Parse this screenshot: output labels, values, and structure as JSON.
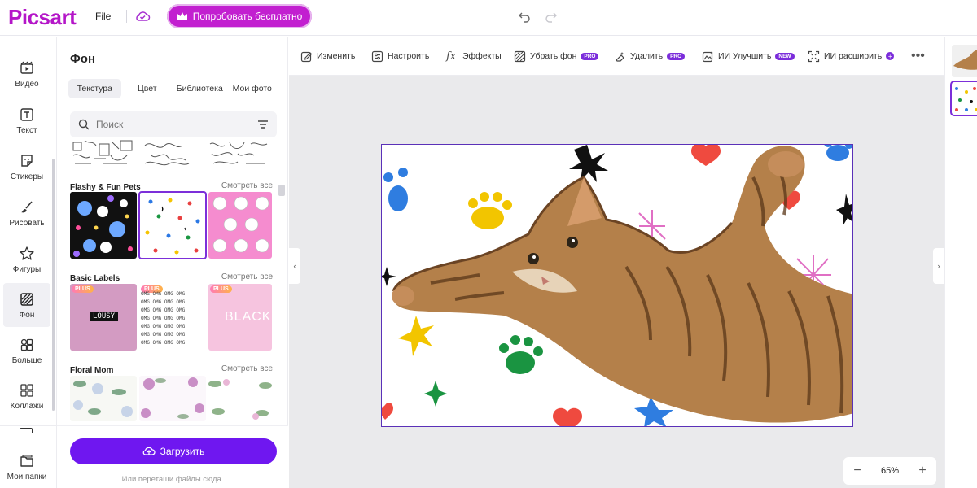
{
  "app": {
    "logo_text": "Picsart",
    "file_label": "File",
    "try_button_label": "Попробовать бесплатно"
  },
  "rail": {
    "items": [
      {
        "label": "Видео",
        "icon": "video-icon"
      },
      {
        "label": "Текст",
        "icon": "text-icon"
      },
      {
        "label": "Стикеры",
        "icon": "sticker-icon"
      },
      {
        "label": "Рисовать",
        "icon": "brush-icon"
      },
      {
        "label": "Фигуры",
        "icon": "star-icon"
      },
      {
        "label": "Фон",
        "icon": "background-icon",
        "active": true
      },
      {
        "label": "Больше",
        "icon": "grid-icon"
      },
      {
        "label": "Коллажи",
        "icon": "collage-icon"
      },
      {
        "label": "Мои папки",
        "icon": "folder-icon"
      }
    ]
  },
  "panel": {
    "title": "Фон",
    "tabs": [
      "Текстура",
      "Цвет",
      "Библиотека",
      "Мои фото"
    ],
    "active_tab": "Текстура",
    "search_placeholder": "Поиск",
    "sections": [
      {
        "title": "Flashy & Fun Pets",
        "see_all": "Смотреть все"
      },
      {
        "title": "Basic Labels",
        "see_all": "Смотреть все",
        "badges": [
          "PLUS",
          "PLUS",
          "PLUS"
        ],
        "thumb_texts": [
          "LOUSY",
          "OMG",
          "BLACK"
        ]
      },
      {
        "title": "Floral Mom",
        "see_all": "Смотреть все"
      }
    ],
    "upload_label": "Загрузить",
    "drop_hint": "Или перетащи файлы сюда."
  },
  "toolbar": {
    "tools": [
      {
        "label": "Изменить",
        "icon": "edit-icon"
      },
      {
        "label": "Настроить",
        "icon": "adjust-icon"
      },
      {
        "label": "Эффекты",
        "icon": "fx-icon"
      },
      {
        "label": "Убрать фон",
        "icon": "remove-bg-icon",
        "badge": "PRO"
      },
      {
        "label": "Удалить",
        "icon": "eraser-icon",
        "badge": "PRO"
      },
      {
        "label": "ИИ Улучшить",
        "icon": "enhance-icon",
        "badge": "NEW"
      },
      {
        "label": "ИИ расширить",
        "icon": "expand-icon"
      }
    ]
  },
  "zoom": {
    "value": "65%",
    "minus": "−",
    "plus": "+"
  },
  "colors": {
    "brand_magenta": "#c21fd0",
    "upload_purple": "#6f17f0",
    "selection_purple": "#7c2fd9",
    "workspace_gray": "#eaeaec"
  }
}
